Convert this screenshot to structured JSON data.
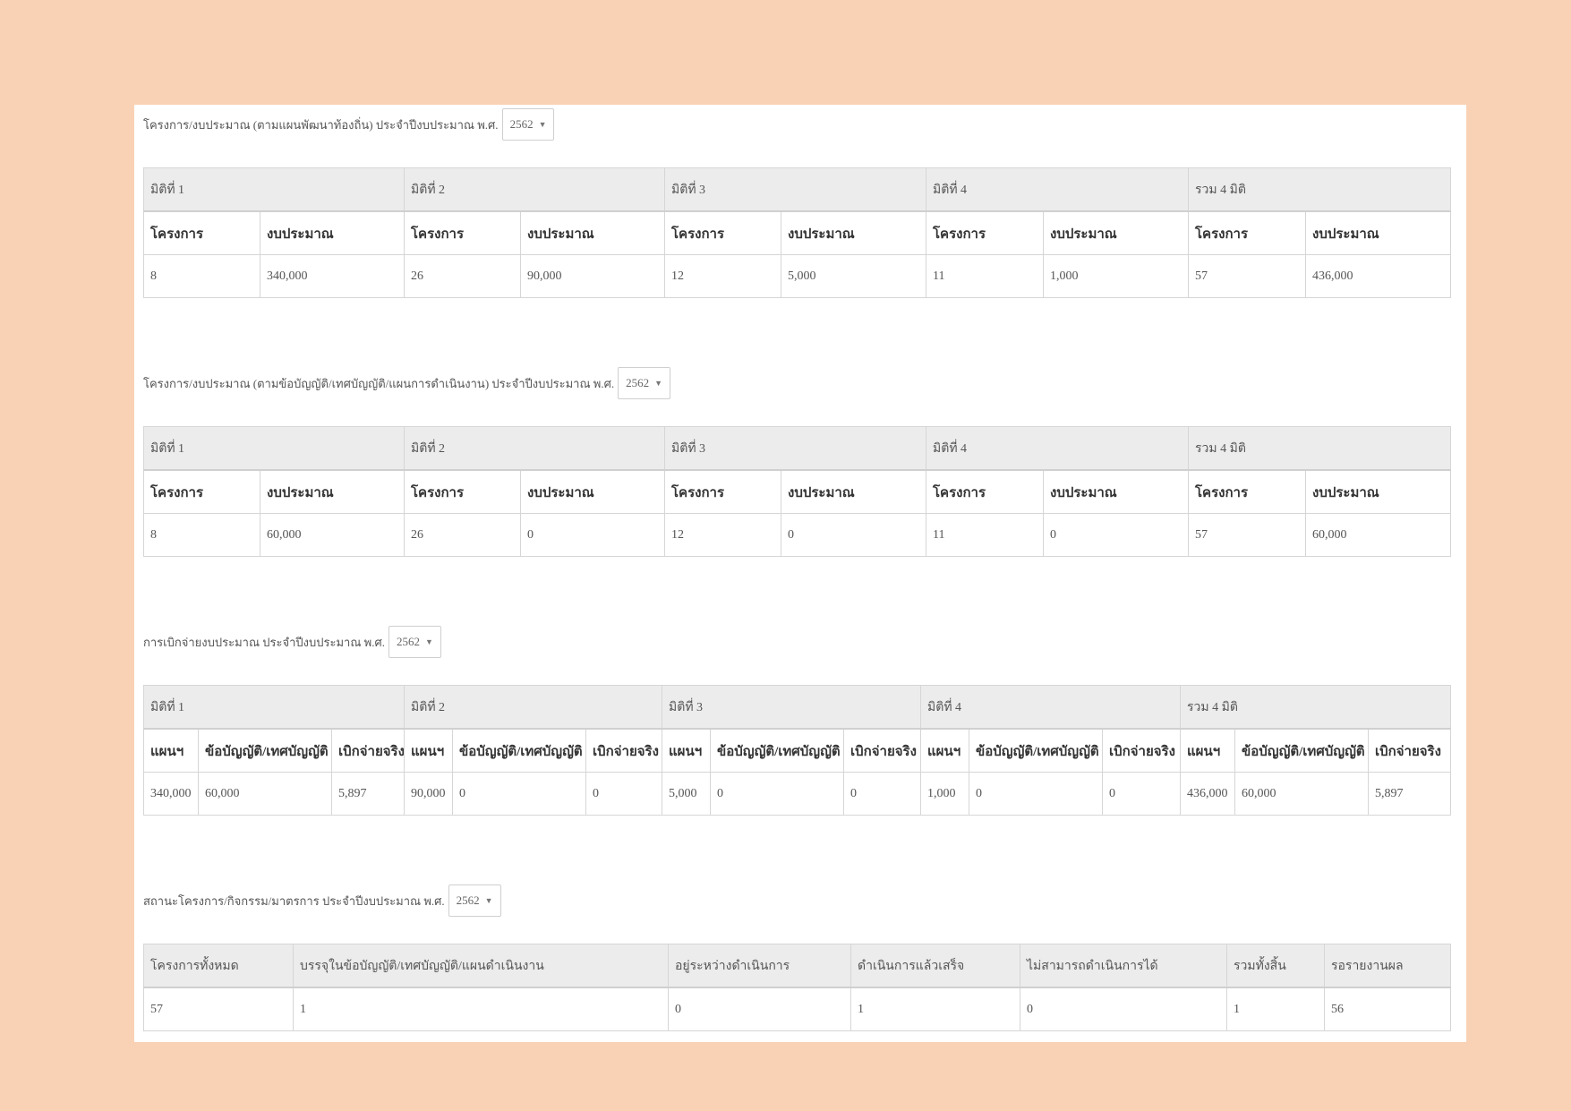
{
  "sections": [
    {
      "title": "โครงการ/งบประมาณ (ตามแผนพัฒนาท้องถิ่น) ประจำปีงบประมาณ พ.ศ.",
      "year": "2562",
      "groups": [
        "มิติที่ 1",
        "มิติที่ 2",
        "มิติที่ 3",
        "มิติที่ 4",
        "รวม 4 มิติ"
      ],
      "subheaders": [
        "โครงการ",
        "งบประมาณ"
      ],
      "values": [
        "8",
        "340,000",
        "26",
        "90,000",
        "12",
        "5,000",
        "11",
        "1,000",
        "57",
        "436,000"
      ]
    },
    {
      "title": "โครงการ/งบประมาณ (ตามข้อบัญญัติ/เทศบัญญัติ/แผนการดำเนินงาน) ประจำปีงบประมาณ พ.ศ.",
      "year": "2562",
      "groups": [
        "มิติที่ 1",
        "มิติที่ 2",
        "มิติที่ 3",
        "มิติที่ 4",
        "รวม 4 มิติ"
      ],
      "subheaders": [
        "โครงการ",
        "งบประมาณ"
      ],
      "values": [
        "8",
        "60,000",
        "26",
        "0",
        "12",
        "0",
        "11",
        "0",
        "57",
        "60,000"
      ]
    },
    {
      "title": "การเบิกจ่ายงบประมาณ ประจำปีงบประมาณ พ.ศ.",
      "year": "2562",
      "groups": [
        "มิติที่ 1",
        "มิติที่ 2",
        "มิติที่ 3",
        "มิติที่ 4",
        "รวม 4 มิติ"
      ],
      "subheaders": [
        "แผนฯ",
        "ข้อบัญญัติ/เทศบัญญัติ",
        "เบิกจ่ายจริง"
      ],
      "values": [
        "340,000",
        "60,000",
        "5,897",
        "90,000",
        "0",
        "0",
        "5,000",
        "0",
        "0",
        "1,000",
        "0",
        "0",
        "436,000",
        "60,000",
        "5,897"
      ]
    },
    {
      "title": "สถานะโครงการ/กิจกรรม/มาตรการ ประจำปีงบประมาณ พ.ศ.",
      "year": "2562",
      "headers": [
        "โครงการทั้งหมด",
        "บรรจุในข้อบัญญัติ/เทศบัญญัติ/แผนดำเนินงาน",
        "อยู่ระหว่างดำเนินการ",
        "ดำเนินการแล้วเสร็จ",
        "ไม่สามารถดำเนินการได้",
        "รวมทั้งสิ้น",
        "รอรายงานผล"
      ],
      "values": [
        "57",
        "1",
        "0",
        "1",
        "0",
        "1",
        "56"
      ]
    }
  ],
  "icons": {
    "select_caret": "caret-down-icon"
  }
}
